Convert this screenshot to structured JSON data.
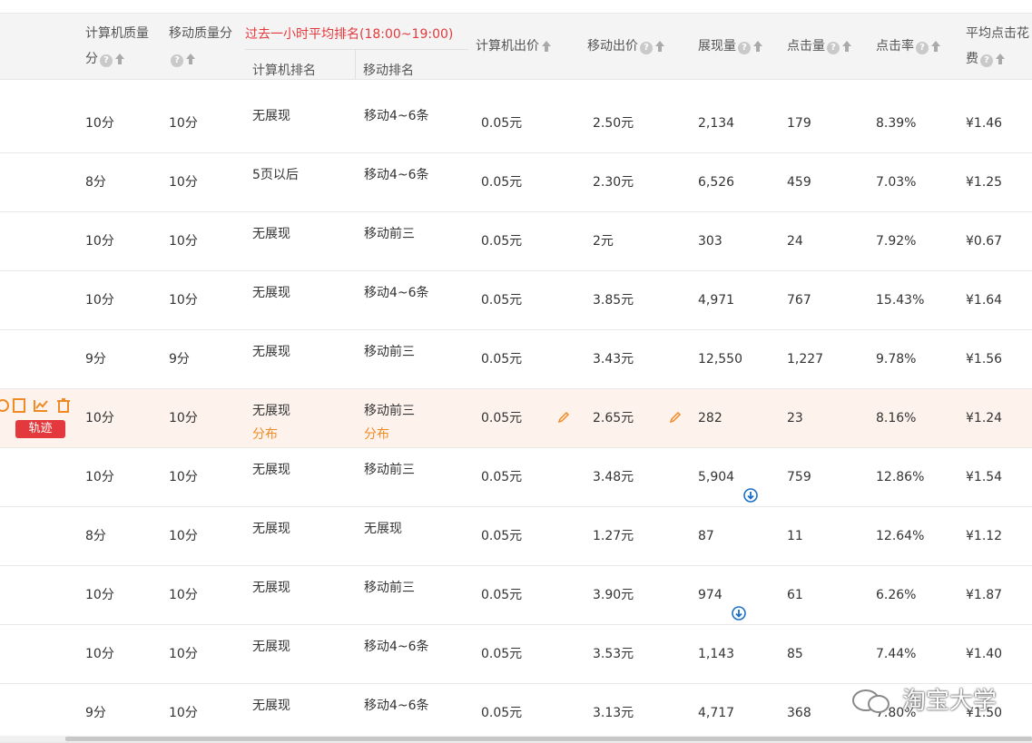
{
  "header": {
    "pc_quality": [
      "计算机质量",
      "分"
    ],
    "mobile_quality": "移动质量分",
    "rank_group": "过去一小时平均排名(18:00~19:00)",
    "pc_rank": "计算机排名",
    "mobile_rank": "移动排名",
    "pc_bid": "计算机出价",
    "mobile_bid": "移动出价",
    "impressions": "展现量",
    "clicks": "点击量",
    "ctr": "点击率",
    "avg_cost": [
      "平均点击花",
      "费"
    ]
  },
  "rows": [
    {
      "pcq": "10分",
      "mq": "10分",
      "pcr": "无展现",
      "mr": "移动4~6条",
      "pcb": "0.05元",
      "mb": "2.50元",
      "imp": "2,134",
      "clk": "179",
      "ctr": "8.39%",
      "cpc": "¥1.46"
    },
    {
      "pcq": "8分",
      "mq": "10分",
      "pcr": "5页以后",
      "mr": "移动4~6条",
      "pcb": "0.05元",
      "mb": "2.30元",
      "imp": "6,526",
      "clk": "459",
      "ctr": "7.03%",
      "cpc": "¥1.25"
    },
    {
      "pcq": "10分",
      "mq": "10分",
      "pcr": "无展现",
      "mr": "移动前三",
      "pcb": "0.05元",
      "mb": "2元",
      "imp": "303",
      "clk": "24",
      "ctr": "7.92%",
      "cpc": "¥0.67"
    },
    {
      "pcq": "10分",
      "mq": "10分",
      "pcr": "无展现",
      "mr": "移动4~6条",
      "pcb": "0.05元",
      "mb": "3.85元",
      "imp": "4,971",
      "clk": "767",
      "ctr": "15.43%",
      "cpc": "¥1.64"
    },
    {
      "pcq": "9分",
      "mq": "9分",
      "pcr": "无展现",
      "mr": "移动前三",
      "pcb": "0.05元",
      "mb": "3.43元",
      "imp": "12,550",
      "clk": "1,227",
      "ctr": "9.78%",
      "cpc": "¥1.56"
    },
    {
      "pcq": "10分",
      "mq": "10分",
      "pcr": "无展现",
      "mr": "移动前三",
      "pcb": "0.05元",
      "mb": "2.65元",
      "imp": "282",
      "clk": "23",
      "ctr": "8.16%",
      "cpc": "¥1.24",
      "dist": "分布",
      "traj": "轨迹"
    },
    {
      "pcq": "10分",
      "mq": "10分",
      "pcr": "无展现",
      "mr": "移动前三",
      "pcb": "0.05元",
      "mb": "3.48元",
      "imp": "5,904",
      "clk": "759",
      "ctr": "12.86%",
      "cpc": "¥1.54",
      "dl": true
    },
    {
      "pcq": "8分",
      "mq": "10分",
      "pcr": "无展现",
      "mr": "无展现",
      "pcb": "0.05元",
      "mb": "1.27元",
      "imp": "87",
      "clk": "11",
      "ctr": "12.64%",
      "cpc": "¥1.12"
    },
    {
      "pcq": "10分",
      "mq": "10分",
      "pcr": "无展现",
      "mr": "移动前三",
      "pcb": "0.05元",
      "mb": "3.90元",
      "imp": "974",
      "clk": "61",
      "ctr": "6.26%",
      "cpc": "¥1.87",
      "dl": true
    },
    {
      "pcq": "10分",
      "mq": "10分",
      "pcr": "无展现",
      "mr": "移动4~6条",
      "pcb": "0.05元",
      "mb": "3.53元",
      "imp": "1,143",
      "clk": "85",
      "ctr": "7.44%",
      "cpc": "¥1.40"
    },
    {
      "pcq": "9分",
      "mq": "10分",
      "pcr": "无展现",
      "mr": "移动4~6条",
      "pcb": "0.05元",
      "mb": "3.13元",
      "imp": "4,717",
      "clk": "368",
      "ctr": "7.80%",
      "cpc": "¥1.50"
    }
  ],
  "watermark": "淘宝大学",
  "colors": {
    "accent_red": "#e4393c",
    "orange": "#f08a24",
    "download_blue": "#1a6fc9",
    "highlight_row": "#fdf3ec"
  }
}
